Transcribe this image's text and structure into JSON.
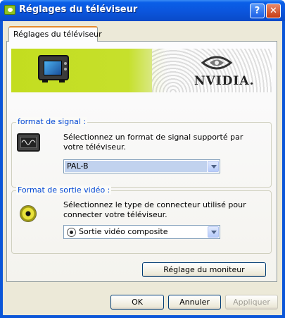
{
  "window": {
    "title": "Réglages du téléviseur",
    "help_glyph": "?",
    "close_glyph": "✕"
  },
  "tabs": [
    {
      "label": "Réglages du téléviseur",
      "active": true
    }
  ],
  "banner": {
    "brand": "NVIDIA."
  },
  "signal_group": {
    "legend": "format de signal :",
    "description": "Sélectionnez un format de signal supporté par votre téléviseur.",
    "selected": "PAL-B"
  },
  "output_group": {
    "legend": "Format de sortie vidéo :",
    "description": "Sélectionnez le type de connecteur utilisé pour connecter votre téléviseur.",
    "selected": "Sortie vidéo composite"
  },
  "buttons": {
    "monitor": "Réglage du moniteur",
    "ok": "OK",
    "cancel": "Annuler",
    "apply": "Appliquer"
  },
  "colors": {
    "titlebar": "#0b55dc",
    "group_legend": "#0046d5",
    "banner_green": "#c3dd1f"
  }
}
